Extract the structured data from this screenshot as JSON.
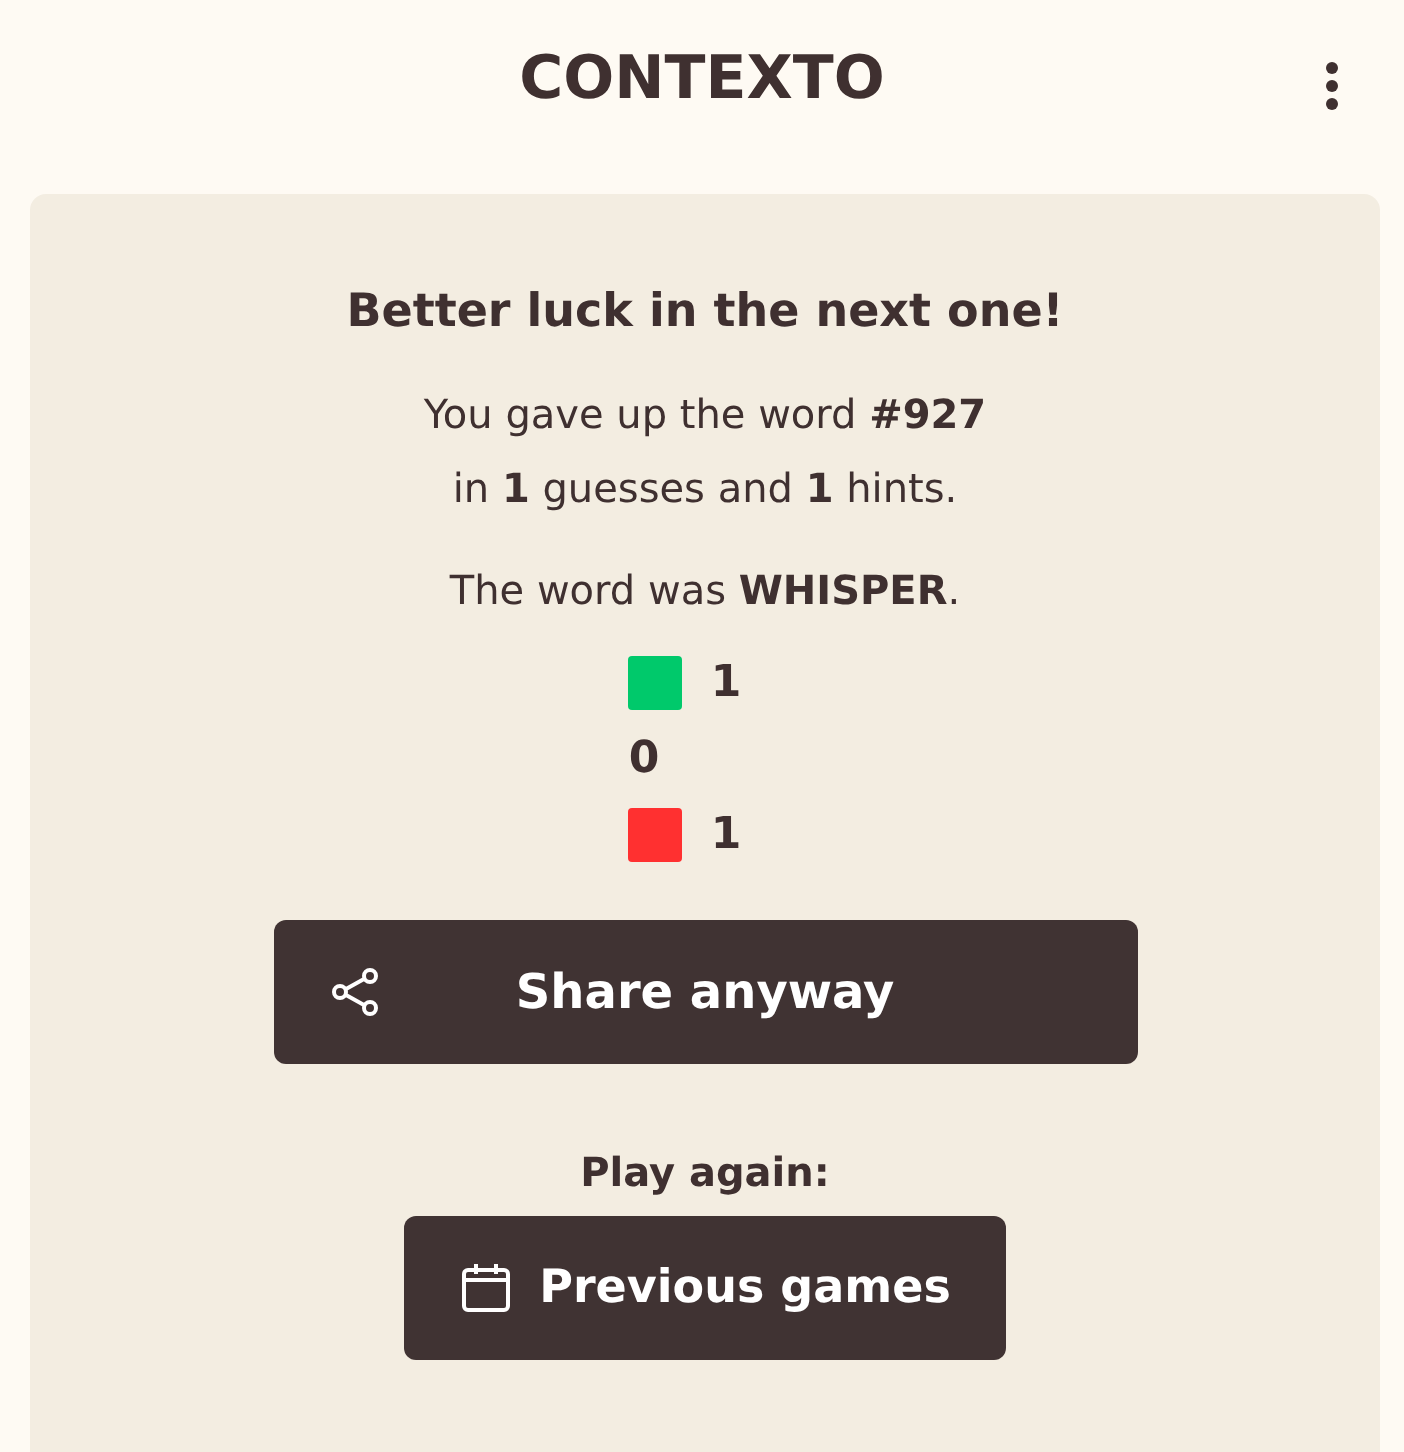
{
  "header": {
    "title": "CONTEXTO"
  },
  "result": {
    "heading": "Better luck in the next one!",
    "summary": [
      "You gave up the word **#927**",
      "in **1** guesses and **1** hints."
    ],
    "answer": "The word was **WHISPER**.",
    "stats": [
      {
        "color": "#00c96b",
        "count": "1"
      },
      {
        "count": "0"
      },
      {
        "color": "#ff3030",
        "count": "1"
      }
    ],
    "share_button": "Share anyway",
    "play_again": "Play again:",
    "previous_button": "Previous games"
  }
}
